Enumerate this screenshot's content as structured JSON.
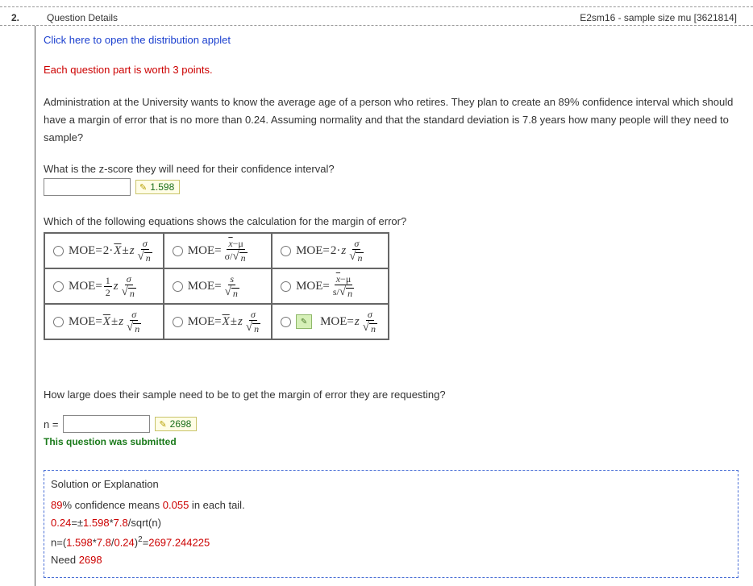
{
  "header": {
    "number": "2.",
    "title": "Question Details",
    "ref": "E2sm16 - sample size mu [3621814]"
  },
  "applet_link": "Click here to open the distribution applet",
  "points_note": "Each question part is worth 3 points.",
  "scenario": "Administration at the University wants to know the average age of a person who retires. They plan to create an 89% confidence interval which should have a margin of error that is no more than 0.24. Assuming normality and that the standard deviation is 7.8 years how many people will they need to sample?",
  "q1": {
    "prompt": "What is the z-score they will need for their confidence interval?",
    "answer": "1.598"
  },
  "q2": {
    "prompt": "Which of the following equations shows the calculation for the margin of error?"
  },
  "q3": {
    "prompt": "How large does their sample need to be to get the margin of error they are requesting?",
    "label": "n =",
    "answer": "2698"
  },
  "submitted_text": "This question was submitted",
  "solution": {
    "title": "Solution or Explanation",
    "line1_a": "89",
    "line1_b": "% confidence means ",
    "line1_c": "0.055",
    "line1_d": " in each tail.",
    "line2_a": "0.24",
    "line2_b": "=±",
    "line2_c": "1.598",
    "line2_d": "*",
    "line2_e": "7.8",
    "line2_f": "/sqrt(n)",
    "line3_a": "n=(",
    "line3_b": "1.598",
    "line3_c": "*",
    "line3_d": "7.8",
    "line3_e": "/",
    "line3_f": "0.24",
    "line3_g": ")",
    "line3_h": "2",
    "line3_i": "=",
    "line3_j": "2697.244225",
    "line4_a": "Need ",
    "line4_b": "2698"
  },
  "moe": {
    "prefix": "MOE="
  }
}
